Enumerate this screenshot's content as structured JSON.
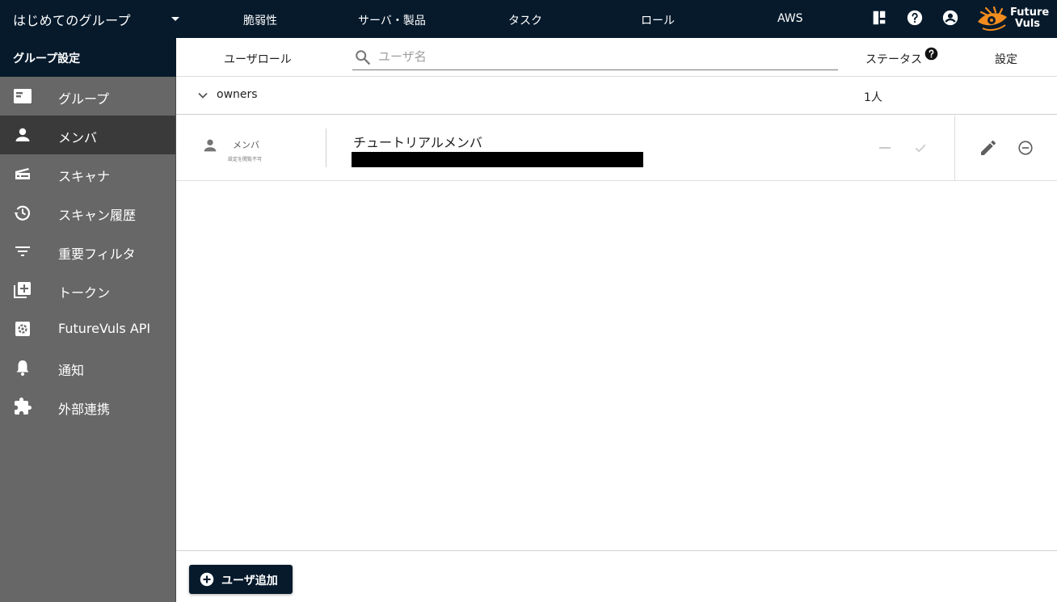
{
  "topbar": {
    "group_name": "はじめてのグループ",
    "nav": [
      {
        "label": "脆弱性"
      },
      {
        "label": "サーバ・製品"
      },
      {
        "label": "タスク"
      },
      {
        "label": "ロール"
      },
      {
        "label": "AWS"
      }
    ],
    "icons": [
      "dashboard-icon",
      "help-icon",
      "account-icon"
    ],
    "logo_line1": "Future",
    "logo_line2": "Vuls",
    "colors": {
      "bar": "#061a2c",
      "logo_accent": "#f28c1e"
    }
  },
  "sidebar": {
    "title": "グループ設定",
    "items": [
      {
        "label": "グループ",
        "icon": "group-card-icon",
        "active": false
      },
      {
        "label": "メンバ",
        "icon": "person-icon",
        "active": true
      },
      {
        "label": "スキャナ",
        "icon": "scanner-icon",
        "active": false
      },
      {
        "label": "スキャン履歴",
        "icon": "history-icon",
        "active": false
      },
      {
        "label": "重要フィルタ",
        "icon": "filter-icon",
        "active": false
      },
      {
        "label": "トークン",
        "icon": "token-icon",
        "active": false
      },
      {
        "label": "FutureVuls API",
        "icon": "api-icon",
        "active": false
      },
      {
        "label": "通知",
        "icon": "bell-icon",
        "active": false
      },
      {
        "label": "外部連携",
        "icon": "puzzle-icon",
        "active": false
      }
    ],
    "colors": {
      "background": "#676767",
      "active": "#3a3a3a"
    }
  },
  "table": {
    "col_role": "ユーザロール",
    "search_placeholder": "ユーザ名",
    "col_status": "ステータス",
    "col_settings": "設定"
  },
  "owners": {
    "name": "owners",
    "count": "1人"
  },
  "member": {
    "role": "メンバ",
    "role_note": "設定を閲覧不可",
    "name": "チュートリアルメンバ",
    "status_dash": "−",
    "status_check": "check-icon"
  },
  "footer": {
    "add_user_label": "ユーザ追加"
  }
}
